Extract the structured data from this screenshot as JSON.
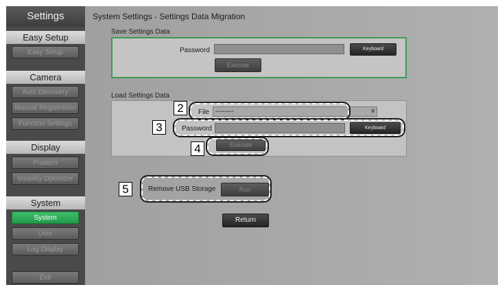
{
  "sidebar": {
    "title": "Settings",
    "sections": [
      {
        "label": "Easy Setup",
        "items": [
          {
            "label": "Easy Setup",
            "active": false
          }
        ]
      },
      {
        "label": "Camera",
        "items": [
          {
            "label": "Auto Discovery",
            "active": false
          },
          {
            "label": "Manual Registration",
            "active": false
          },
          {
            "label": "Function Settings",
            "active": false
          }
        ]
      },
      {
        "label": "Display",
        "items": [
          {
            "label": "Position",
            "active": false
          },
          {
            "label": "Visibility Optimizer",
            "active": false
          }
        ]
      },
      {
        "label": "System",
        "items": [
          {
            "label": "System",
            "active": true
          },
          {
            "label": "User",
            "active": false
          },
          {
            "label": "Log Display",
            "active": false
          }
        ]
      }
    ],
    "exit_label": "Exit"
  },
  "main": {
    "title": "System Settings - Settings Data Migration",
    "save": {
      "section_label": "Save Settings Data",
      "password_label": "Password",
      "password_value": "",
      "keyboard_label": "Keyboard",
      "execute_label": "Execute"
    },
    "load": {
      "section_label": "Load Settings Data",
      "file_label": "File",
      "file_value": "--------",
      "password_label": "Password",
      "password_value": "",
      "keyboard_label": "Keyboard",
      "execute_label": "Execute"
    },
    "usb": {
      "label": "Remove USB Storage",
      "button_label": "Run"
    },
    "return_label": "Return"
  },
  "callouts": [
    "2",
    "3",
    "4",
    "5"
  ],
  "colors": {
    "accent_green": "#3d9a55",
    "active_item": "#1f9a49",
    "callout_border": "#ffffff"
  }
}
